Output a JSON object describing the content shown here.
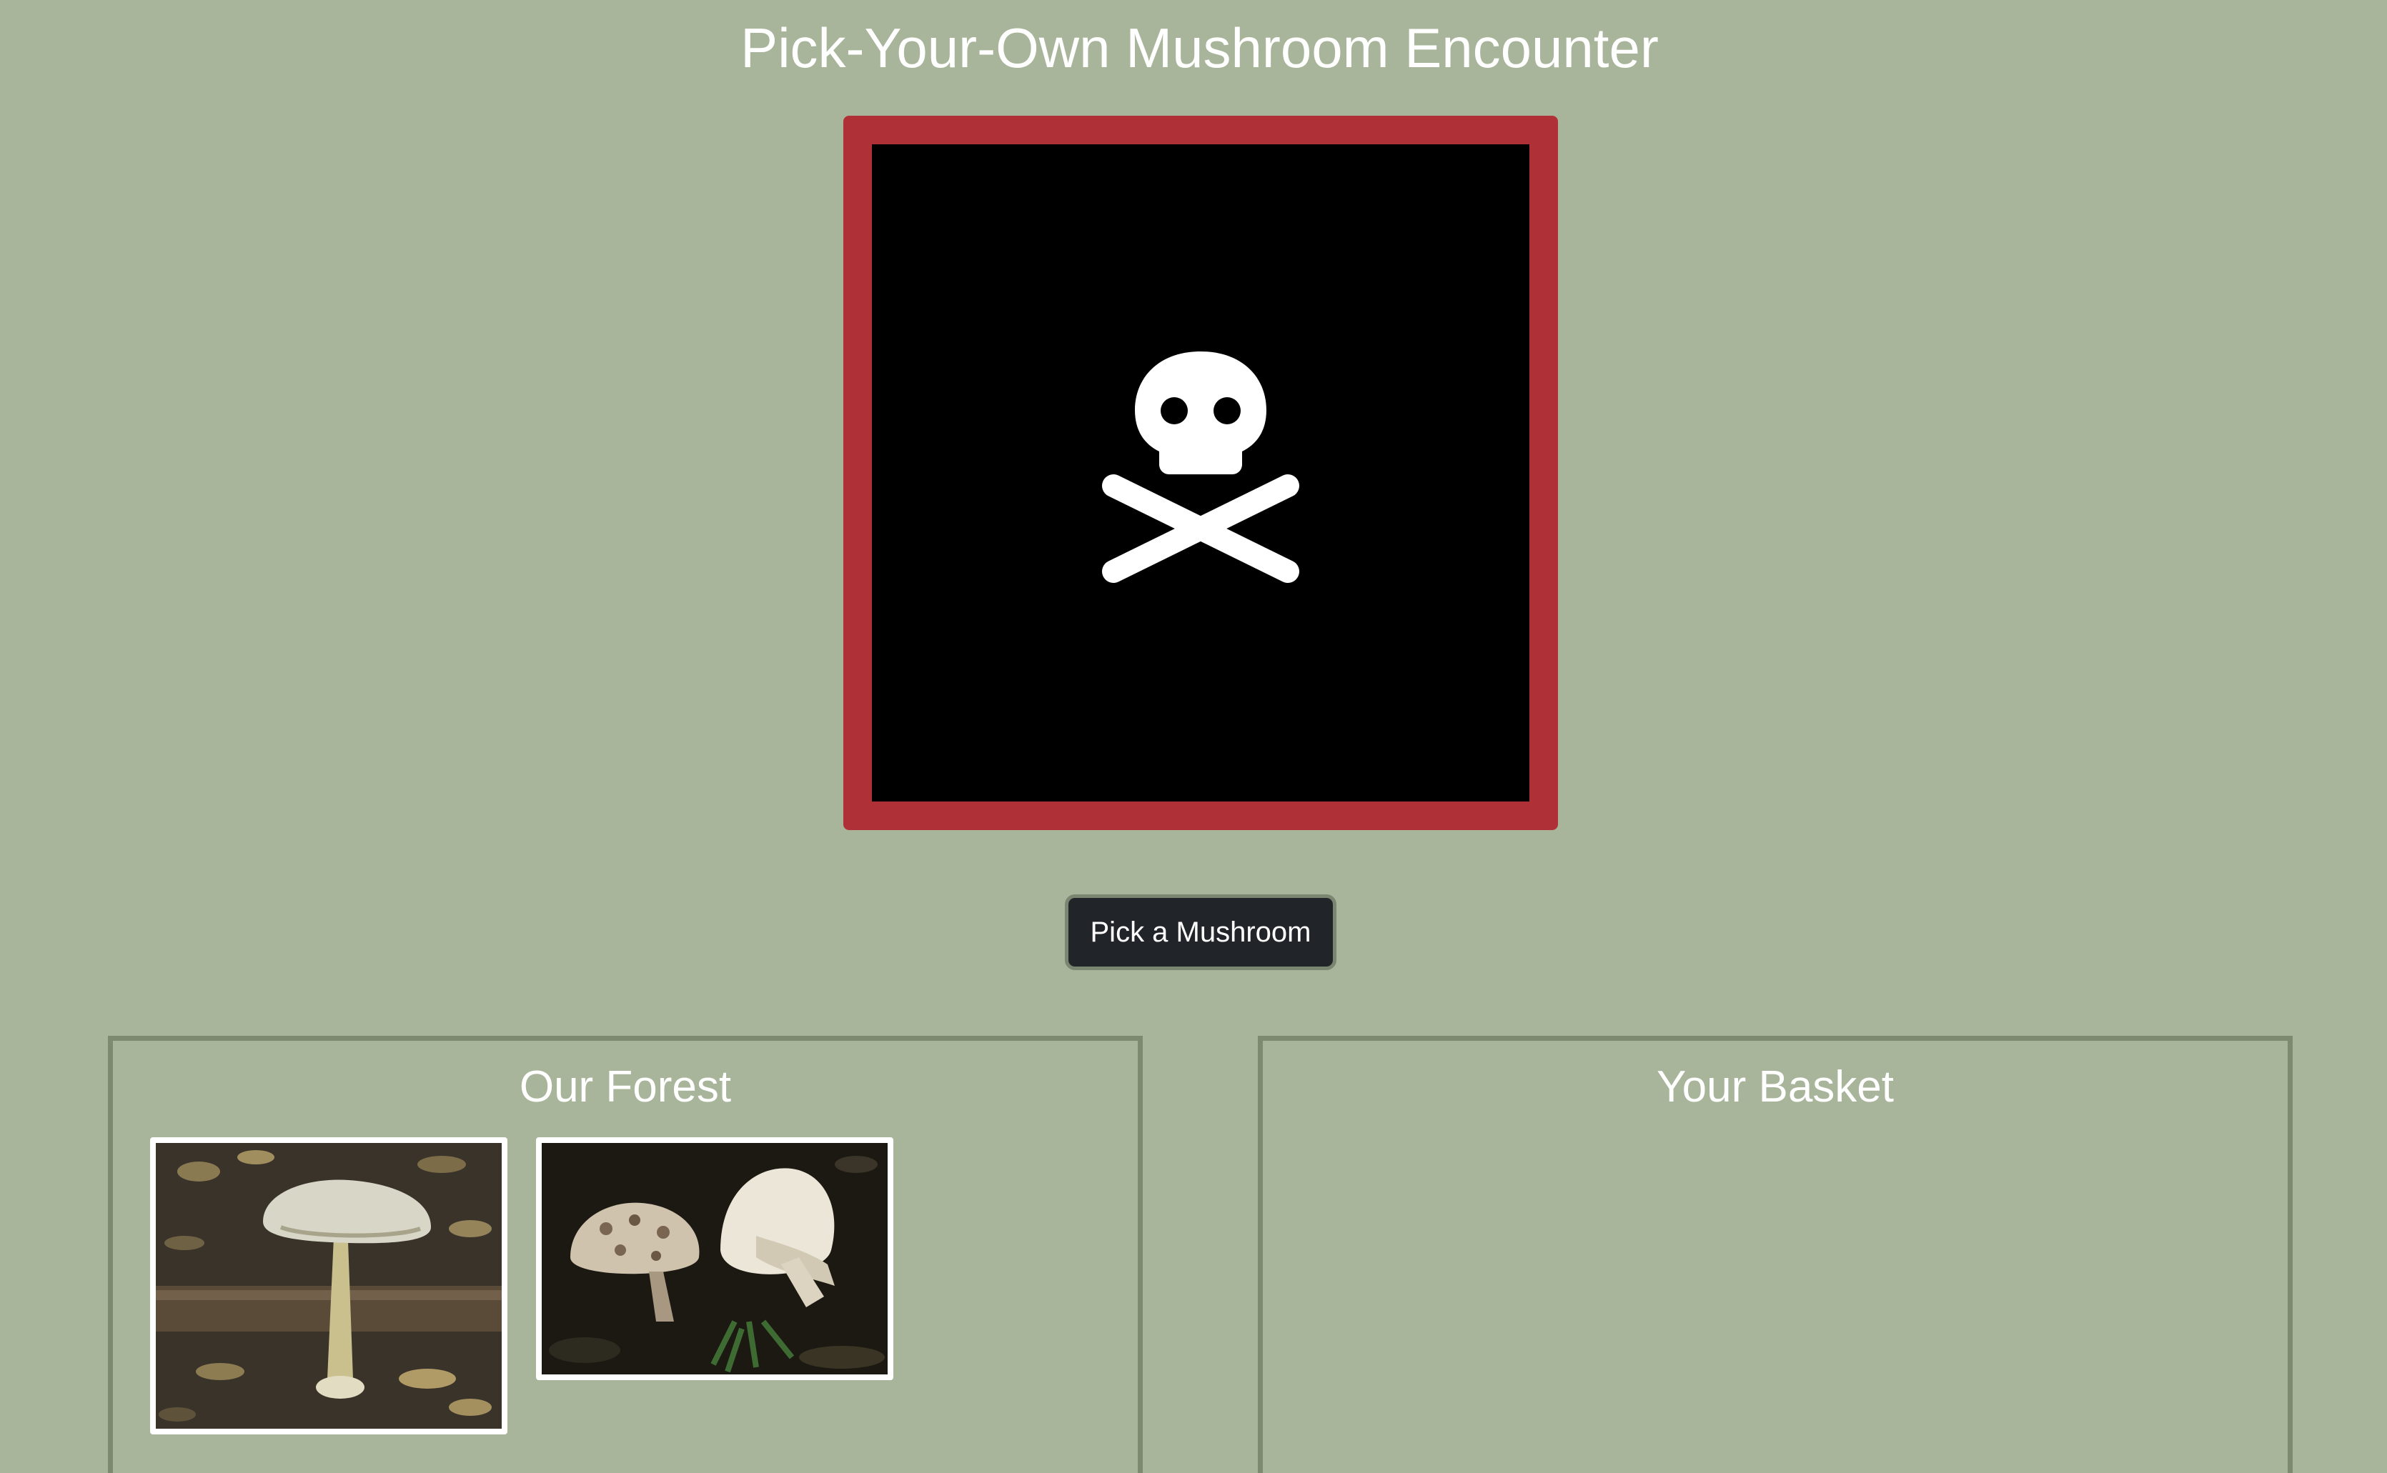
{
  "page": {
    "title": "Pick-Your-Own Mushroom Encounter"
  },
  "encounter": {
    "icon": "skull-crossbones-icon",
    "frame_color": "#b03038",
    "screen_color": "#000000"
  },
  "actions": {
    "pick_label": "Pick a Mushroom"
  },
  "forest": {
    "title": "Our Forest",
    "items": [
      {
        "icon": "mushroom-photo-tall-pale-cap"
      },
      {
        "icon": "mushroom-photo-two-white-caps"
      }
    ]
  },
  "basket": {
    "title": "Your Basket",
    "items": []
  },
  "colors": {
    "background": "#a8b59a",
    "button": "#212529",
    "panel_border": "#7d8a70"
  }
}
